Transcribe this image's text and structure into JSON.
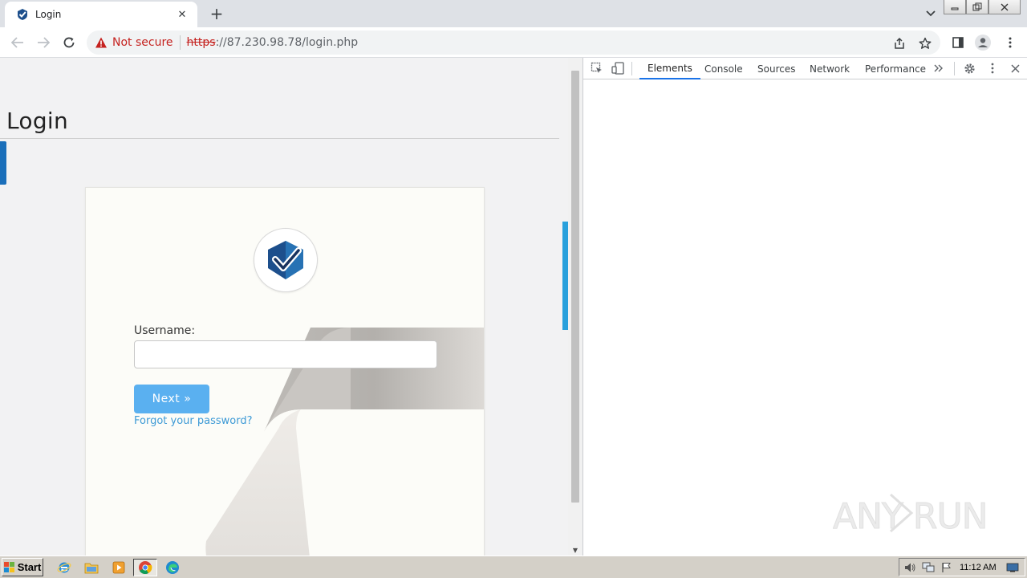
{
  "browser": {
    "tab": {
      "title": "Login",
      "favicon": "checkmark-shield-icon"
    },
    "new_tab_icon": "plus-icon",
    "tab_search_icon": "chevron-down-icon",
    "window_controls": [
      "minimize-icon",
      "restore-icon",
      "close-icon"
    ],
    "toolbar": {
      "back_icon": "arrow-left-icon",
      "forward_icon": "arrow-right-icon",
      "reload_icon": "reload-icon",
      "security_label": "Not secure",
      "url_scheme": "https",
      "url_rest": "://87.230.98.78/login.php",
      "share_icon": "share-icon",
      "bookmark_icon": "star-icon",
      "sidepanel_icon": "side-panel-icon",
      "profile_icon": "profile-icon",
      "menu_icon": "kebab-menu-icon"
    }
  },
  "page": {
    "heading": "Login",
    "form": {
      "username_label": "Username:",
      "username_value": "",
      "next_label": "Next »",
      "forgot_label": "Forgot your password?"
    },
    "colors": {
      "accent_blue": "#1a6fba",
      "button_blue": "#5ab0f0",
      "link_blue": "#3d9ad6"
    }
  },
  "devtools": {
    "tabs": [
      "Elements",
      "Console",
      "Sources",
      "Network",
      "Performance"
    ],
    "active_tab": "Elements",
    "more_tabs_icon": "double-chevron-right-icon",
    "settings_icon": "gear-icon",
    "menu_icon": "kebab-menu-icon",
    "close_icon": "close-icon"
  },
  "watermark": "ANY RUN",
  "taskbar": {
    "start_label": "Start",
    "apps": [
      "internet-explorer-icon",
      "file-explorer-icon",
      "media-player-icon",
      "chrome-icon",
      "edge-icon"
    ],
    "clock": "11:12 AM"
  }
}
